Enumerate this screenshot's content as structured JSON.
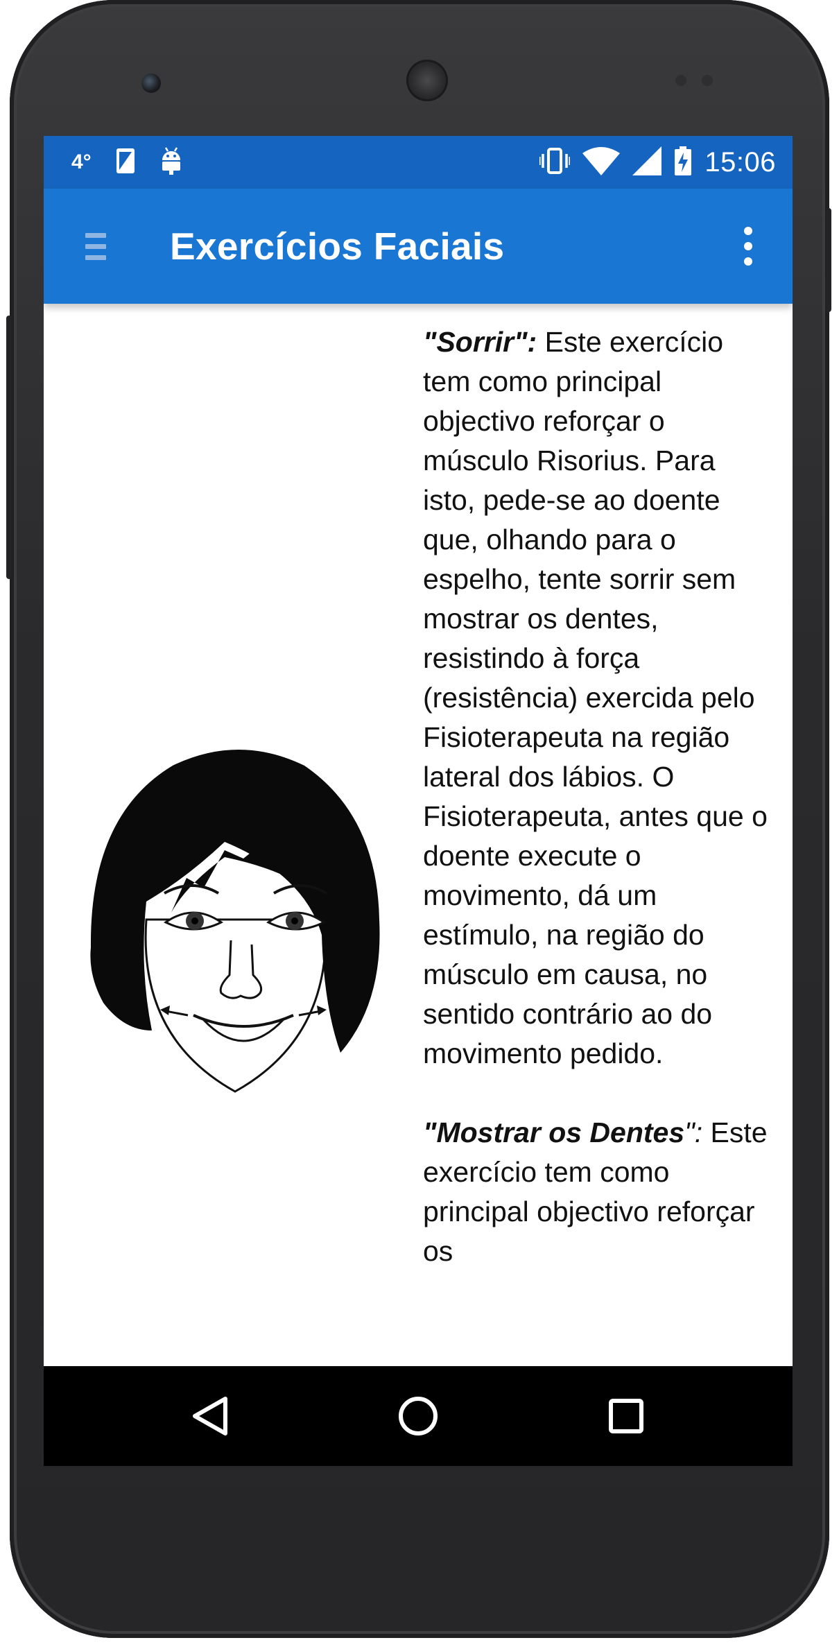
{
  "status_bar": {
    "temperature": "4°",
    "time": "15:06",
    "left_icons": [
      "temperature-indicator",
      "screenshot-icon",
      "android-icon"
    ],
    "right_icons": [
      "vibrate-icon",
      "wifi-icon",
      "signal-icon",
      "battery-charging-icon"
    ]
  },
  "app_bar": {
    "title": "Exercícios Faciais",
    "menu_icon": "hamburger-menu-icon",
    "overflow_icon": "more-vert-icon",
    "color": "#1976d2",
    "status_color": "#1565c0"
  },
  "content": {
    "illustration": "face-smile-illustration",
    "exercise_1": {
      "title": "\"Sorrir\":",
      "body": " Este exercício tem como principal objectivo reforçar o músculo Risorius. Para isto, pede-se ao doente que, olhando para o espelho, tente sorrir sem mostrar os dentes, resistindo à força (resistência) exercida pelo Fisioterapeuta na região lateral dos lábios. O Fisioterapeuta, antes que o doente execute o movimento, dá um estímulo, na região do músculo em causa, no sentido contrário ao do movimento pedido."
    },
    "exercise_2": {
      "title": "\"Mostrar os Dentes",
      "title_suffix": "\":",
      "body": " Este exercício tem como principal objectivo reforçar os"
    }
  },
  "nav_bar": {
    "back_icon": "back-triangle-icon",
    "home_icon": "home-circle-icon",
    "recents_icon": "recents-square-icon"
  }
}
